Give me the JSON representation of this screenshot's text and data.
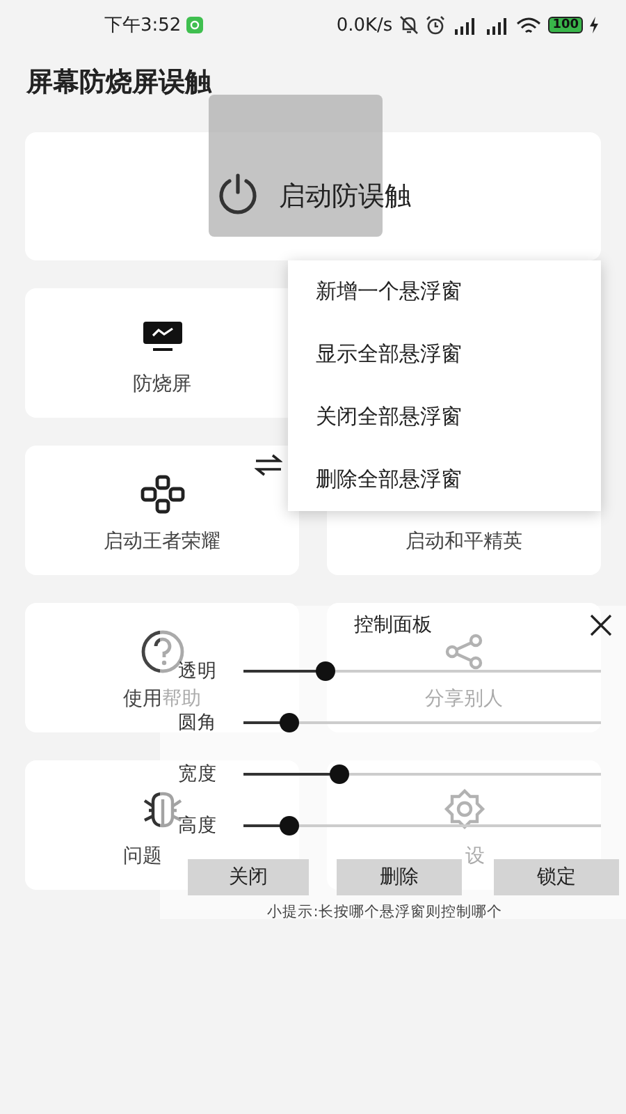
{
  "status_bar": {
    "time": "下午3:52",
    "net_speed": "0.0K/s",
    "battery": "100"
  },
  "app_title": "屏幕防烧屏误触",
  "main_button": {
    "label": "启动防误触"
  },
  "tiles": [
    {
      "kind": "monitor",
      "label": "防烧屏"
    },
    {
      "kind": "blank"
    },
    {
      "kind": "gamepad",
      "label": "启动王者荣耀"
    },
    {
      "kind": "text",
      "label": "启动和平精英"
    },
    {
      "kind": "question",
      "label": "使用帮助"
    },
    {
      "kind": "share",
      "label": "分享别人"
    },
    {
      "kind": "bug",
      "label": "问题"
    },
    {
      "kind": "gear",
      "label": "设"
    }
  ],
  "menu": {
    "items": [
      "新增一个悬浮窗",
      "显示全部悬浮窗",
      "关闭全部悬浮窗",
      "删除全部悬浮窗"
    ]
  },
  "control_panel": {
    "title": "控制面板",
    "sliders": [
      {
        "label": "透明",
        "level": 0.23
      },
      {
        "label": "圆角",
        "level": 0.13
      },
      {
        "label": "宽度",
        "level": 0.27
      },
      {
        "label": "高度",
        "level": 0.13
      }
    ],
    "buttons": [
      "关闭",
      "删除",
      "锁定"
    ],
    "hint": "小提示:长按哪个悬浮窗则控制哪个"
  }
}
